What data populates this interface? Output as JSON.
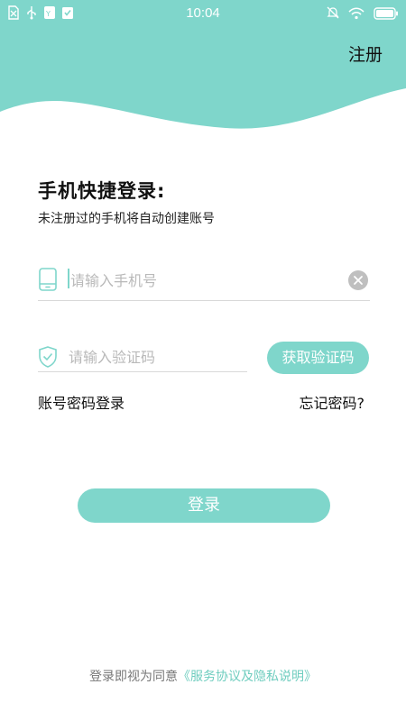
{
  "status_bar": {
    "time": "10:04",
    "left_icons": [
      "sim-icon",
      "usb-icon",
      "app-notification-icon",
      "task-icon"
    ],
    "right_icons": [
      "mute-icon",
      "wifi-icon",
      "battery-icon"
    ]
  },
  "header": {
    "register_label": "注册"
  },
  "login": {
    "title": "手机快捷登录:",
    "subtitle": "未注册过的手机将自动创建账号",
    "phone_placeholder": "请输入手机号",
    "code_placeholder": "请输入验证码",
    "get_code_label": "获取验证码",
    "password_login_label": "账号密码登录",
    "forgot_password_label": "忘记密码?",
    "submit_label": "登录"
  },
  "footer": {
    "agreement_prefix": "登录即视为同意",
    "agreement_link": "《服务协议及隐私说明》"
  },
  "colors": {
    "accent": "#7fd6cb",
    "hint": "#b9b9b9",
    "divider": "#d9d9d9"
  }
}
